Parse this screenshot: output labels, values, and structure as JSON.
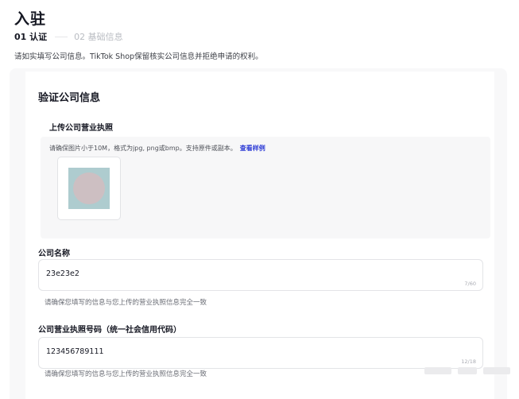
{
  "header": {
    "title": "入驻",
    "steps": [
      {
        "label": "01 认证",
        "active": true
      },
      {
        "label": "02 基础信息",
        "active": false
      }
    ],
    "notice": "请如实填写公司信息。TikTok Shop保留核实公司信息并拒绝申请的权利。"
  },
  "section": {
    "title": "验证公司信息",
    "upload": {
      "label": "上传公司营业执照",
      "hint": "请确保图片小于10M，格式为jpg, png或bmp。支持原件或副本。",
      "sample_link": "查看样例"
    },
    "company_name": {
      "label": "公司名称",
      "value": "23e23e2",
      "count": "7/60",
      "help": "请确保您填写的信息与您上传的营业执照信息完全一致"
    },
    "license_number": {
      "label": "公司营业执照号码（统一社会信用代码）",
      "value": "123456789111",
      "count": "12/18",
      "help": "请确保您填写的信息与您上传的营业执照信息完全一致"
    }
  },
  "colors": {
    "text": "#161823",
    "link": "#2f3dd6",
    "muted": "#b9bcc2",
    "card_bg": "#f8f8f9"
  }
}
